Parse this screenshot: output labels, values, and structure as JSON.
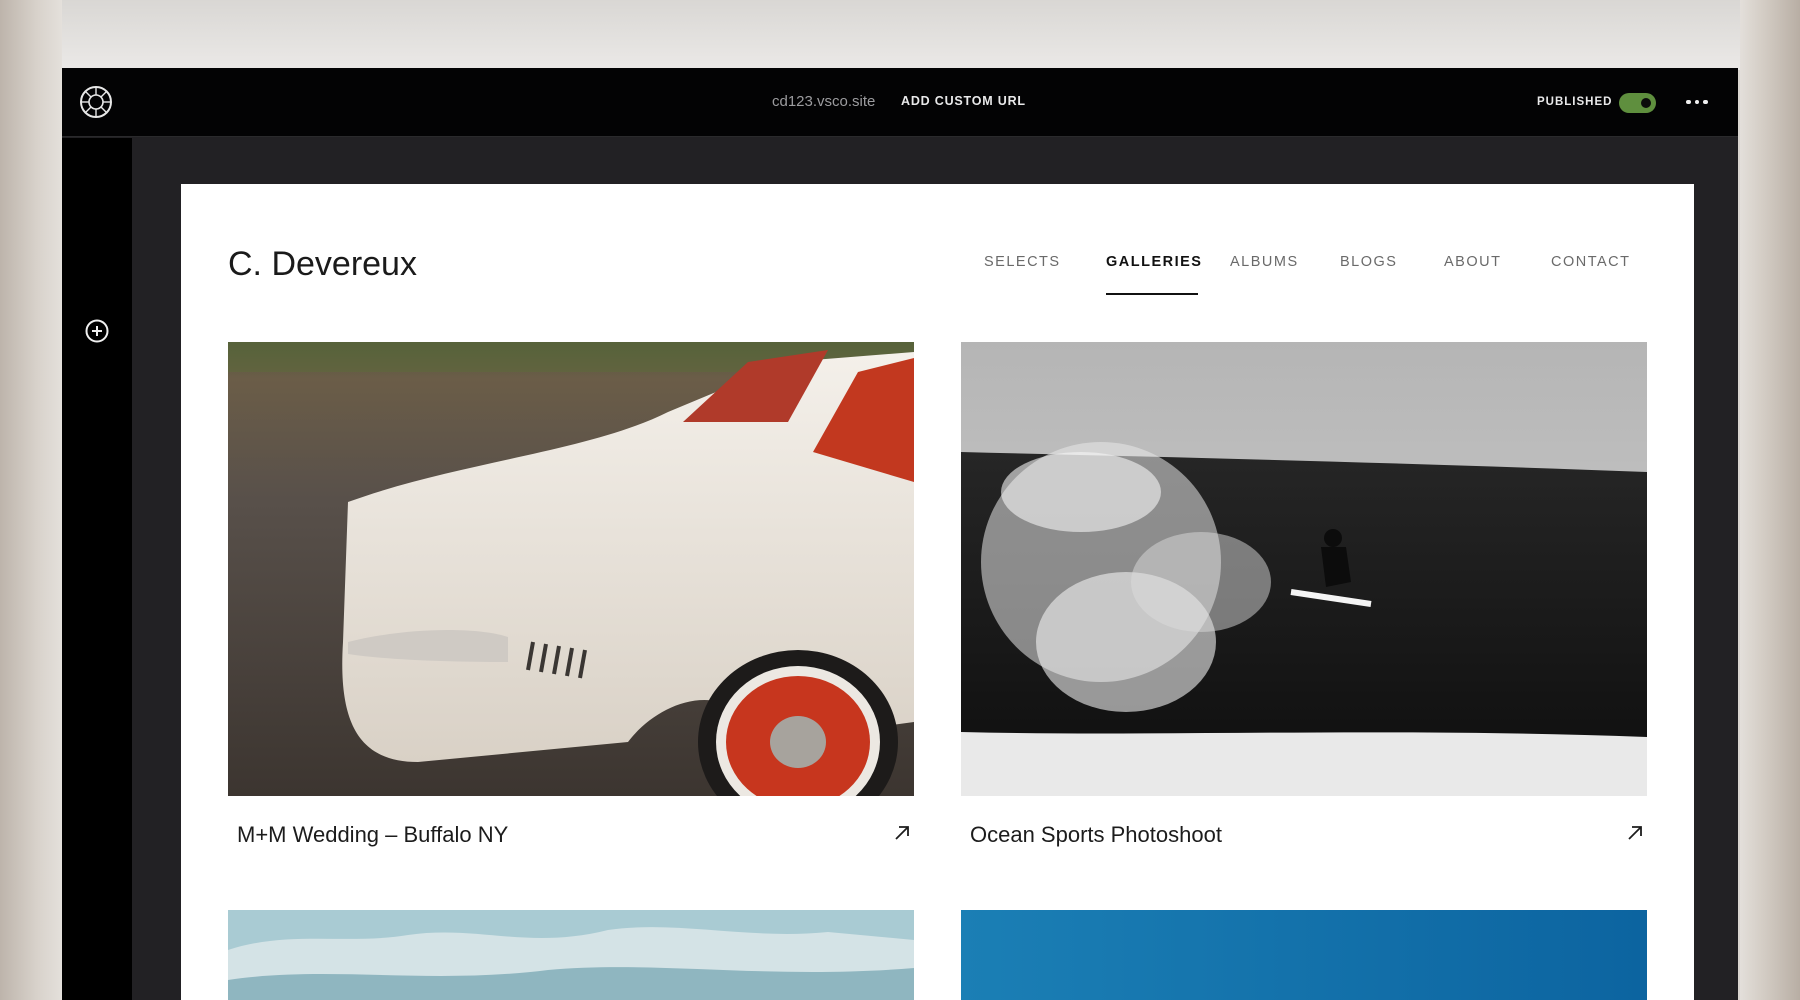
{
  "topbar": {
    "site_url": "cd123.vsco.site",
    "add_custom_url": "ADD CUSTOM URL",
    "published_label": "PUBLISHED",
    "published_on": true
  },
  "icons": {
    "logo": "vsco-logo-icon",
    "more": "more-horizontal-icon",
    "add": "plus-circle-icon",
    "external": "arrow-up-right-icon"
  },
  "site": {
    "brand": "C. Devereux",
    "nav": [
      {
        "label": "SELECTS",
        "active": false
      },
      {
        "label": "GALLERIES",
        "active": true
      },
      {
        "label": "ALBUMS",
        "active": false
      },
      {
        "label": "BLOGS",
        "active": false
      },
      {
        "label": "ABOUT",
        "active": false
      },
      {
        "label": "CONTACT",
        "active": false
      }
    ]
  },
  "galleries": [
    {
      "title": "M+M  Wedding – Buffalo NY"
    },
    {
      "title": "Ocean Sports Photoshoot"
    },
    {
      "title": ""
    },
    {
      "title": ""
    }
  ],
  "colors": {
    "topbar": "#030304",
    "sidebar": "#000000",
    "workspace": "#222124",
    "toggle_on": "#5f8f3e",
    "page": "#ffffff"
  }
}
